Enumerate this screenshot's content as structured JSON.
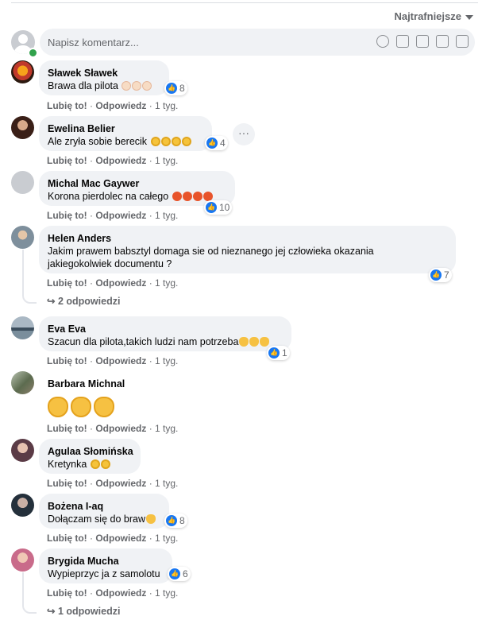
{
  "sort": {
    "label": "Najtrafniejsze"
  },
  "composer": {
    "placeholder": "Napisz komentarz..."
  },
  "action_like": "Lubię to!",
  "action_reply": "Odpowiedz",
  "separator": "·",
  "comments": [
    {
      "name": "Sławek Sławek",
      "text": "Brawa dla pilota",
      "reactions": "8",
      "time": "1 tyg."
    },
    {
      "name": "Ewelina Belier",
      "text": "Ale zryła sobie berecik",
      "reactions": "4",
      "time": "1 tyg."
    },
    {
      "name": "Michal Mac Gaywer",
      "text": "Korona pierdolec na całego",
      "reactions": "10",
      "time": "1 tyg."
    },
    {
      "name": "Helen Anders",
      "text": "Jakim prawem babsztyl domaga sie od nieznanego jej człowieka okazania jakiegokolwiek documentu ?",
      "reactions": "7",
      "time": "1 tyg.",
      "replies": "2 odpowiedzi"
    },
    {
      "name": "Eva Eva",
      "text": "Szacun dla pilota,takich ludzi nam potrzeba",
      "reactions": "1",
      "time": "1 tyg."
    },
    {
      "name": "Barbara Michnal",
      "text": "",
      "time": "1 tyg."
    },
    {
      "name": "Agulaa Słomińska",
      "text": "Kretynka",
      "time": "1 tyg."
    },
    {
      "name": "Bożena I-aq",
      "text": "Dołączam się do braw",
      "reactions": "8",
      "time": "1 tyg."
    },
    {
      "name": "Brygida Mucha",
      "text": "Wypieprzyc ja z samolotu",
      "reactions": "6",
      "time": "1 tyg.",
      "replies": "1 odpowiedzi"
    }
  ],
  "colors": {
    "like": "#1877f2",
    "bubble": "#f0f2f5",
    "meta": "#65676b"
  }
}
